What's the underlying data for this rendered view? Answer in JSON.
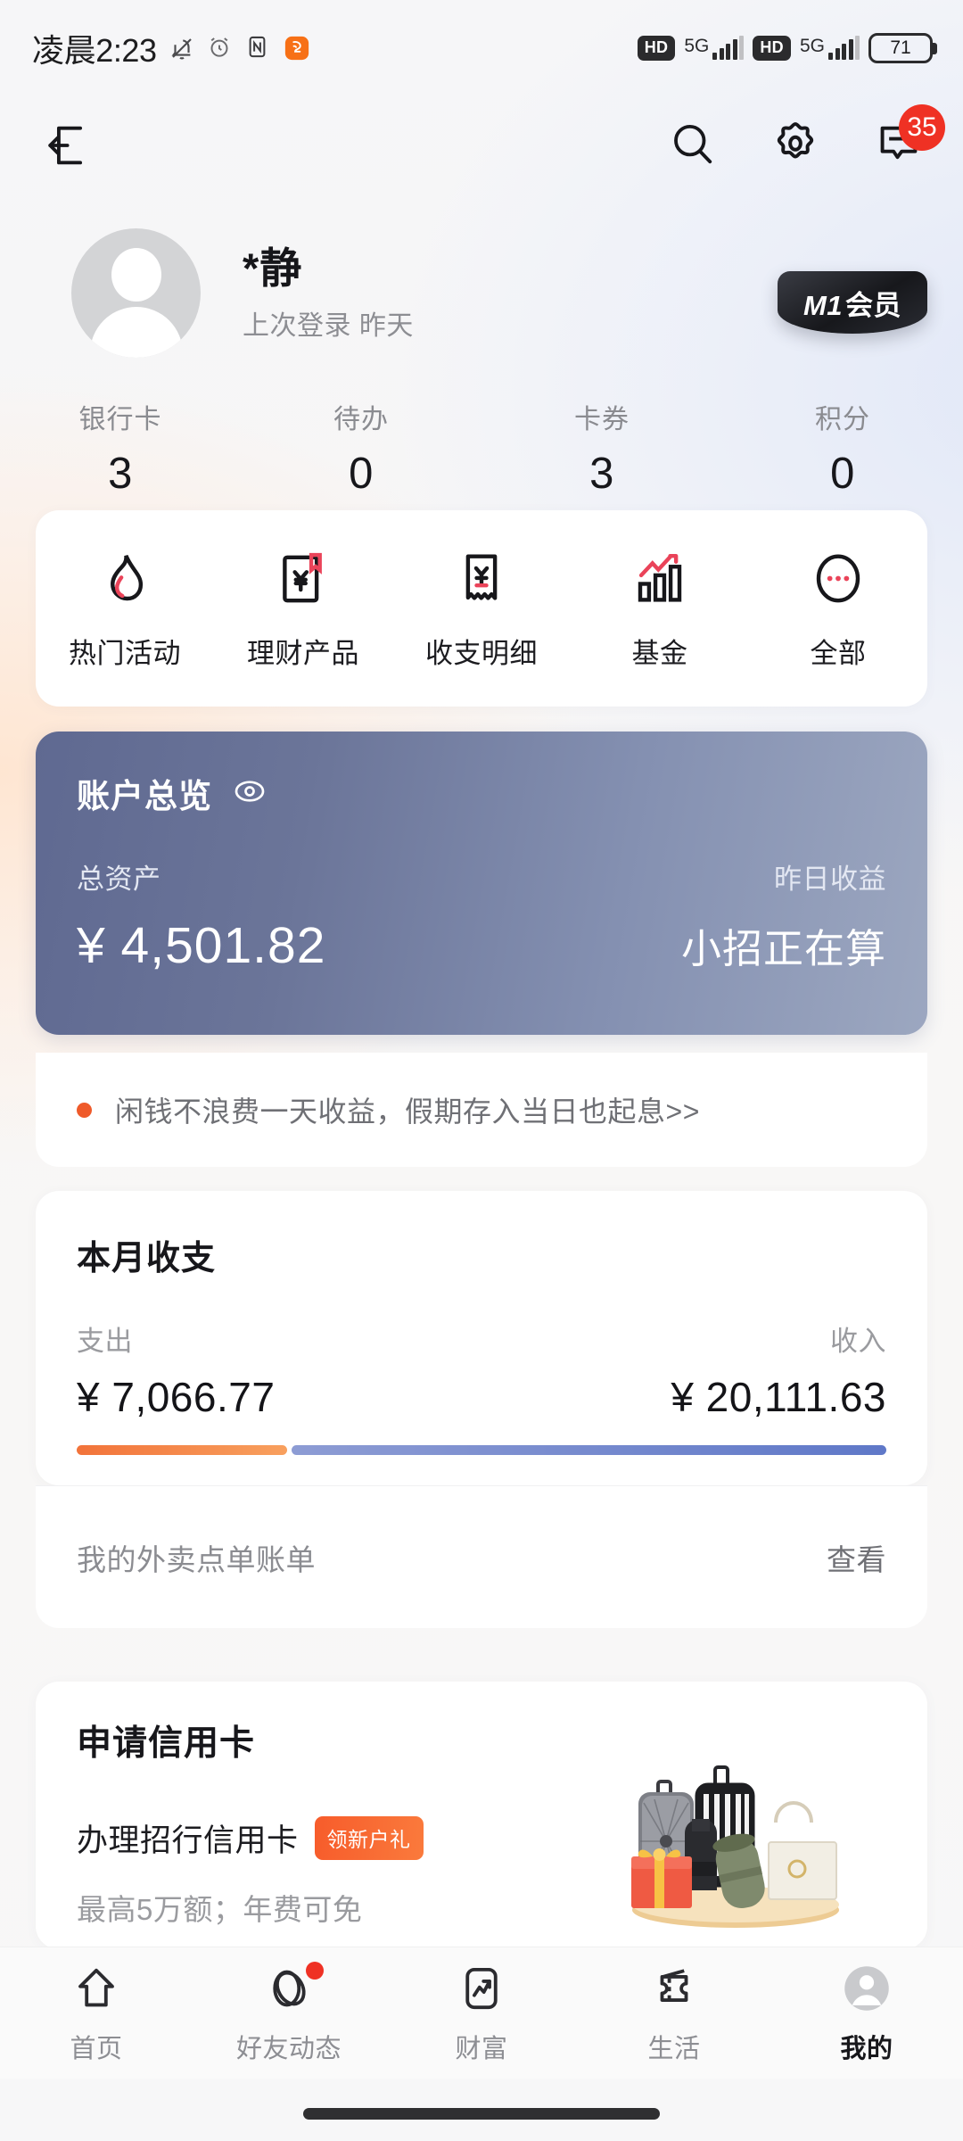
{
  "status_bar": {
    "time": "凌晨2:23",
    "icons_left": [
      "bell-muted-icon",
      "alarm-icon",
      "nfc-icon",
      "app-squirrel-icon"
    ],
    "network": [
      {
        "hd": "HD",
        "gen": "5G"
      },
      {
        "hd": "HD",
        "gen": "5G"
      }
    ],
    "battery_percent": "71"
  },
  "header": {
    "back_icon": "exit-back-icon",
    "search_icon": "search-icon",
    "settings_icon": "gear-icon",
    "message_icon": "message-icon",
    "message_badge": "35"
  },
  "profile": {
    "avatar_icon": "avatar-placeholder-icon",
    "name": "*静",
    "last_login": "上次登录 昨天",
    "member_level": "M1",
    "member_label": "会员"
  },
  "stats": [
    {
      "label": "银行卡",
      "value": "3"
    },
    {
      "label": "待办",
      "value": "0"
    },
    {
      "label": "卡券",
      "value": "3"
    },
    {
      "label": "积分",
      "value": "0"
    }
  ],
  "quick_actions": [
    {
      "label": "热门活动",
      "icon": "flame-icon"
    },
    {
      "label": "理财产品",
      "icon": "wealth-card-icon"
    },
    {
      "label": "收支明细",
      "icon": "receipt-icon"
    },
    {
      "label": "基金",
      "icon": "bar-chart-trend-icon"
    },
    {
      "label": "全部",
      "icon": "more-dots-icon"
    }
  ],
  "account_overview": {
    "title": "账户总览",
    "eye_icon": "eye-icon",
    "total_assets_label": "总资产",
    "total_assets_value": "¥ 4,501.82",
    "yesterday_label": "昨日收益",
    "yesterday_value": "小招正在算"
  },
  "tip": {
    "text": "闲钱不浪费一天收益，假期存入当日也起息>>",
    "dot_color": "#ef5a2a"
  },
  "monthly": {
    "title": "本月收支",
    "expense_label": "支出",
    "expense_value": "¥ 7,066.77",
    "income_label": "收入",
    "income_value": "¥ 20,111.63",
    "expense_ratio_percent": 26,
    "expense_bar_color": "#f2733a",
    "income_bar_color": "#6b80cc"
  },
  "takeout_row": {
    "label": "我的外卖点单账单",
    "action": "查看"
  },
  "credit_card": {
    "title": "申请信用卡",
    "subtitle": "办理招行信用卡",
    "badge": "领新户礼",
    "description": "最高5万额；年费可免",
    "illustration": "luggage-gift-illustration"
  },
  "tabbar": [
    {
      "label": "首页",
      "icon": "home-arrow-icon",
      "active": false,
      "dot": false
    },
    {
      "label": "好友动态",
      "icon": "friends-activity-icon",
      "active": false,
      "dot": true
    },
    {
      "label": "财富",
      "icon": "wealth-trend-icon",
      "active": false,
      "dot": false
    },
    {
      "label": "生活",
      "icon": "life-ticket-icon",
      "active": false,
      "dot": false
    },
    {
      "label": "我的",
      "icon": "profile-avatar-icon",
      "active": true,
      "dot": false
    }
  ]
}
